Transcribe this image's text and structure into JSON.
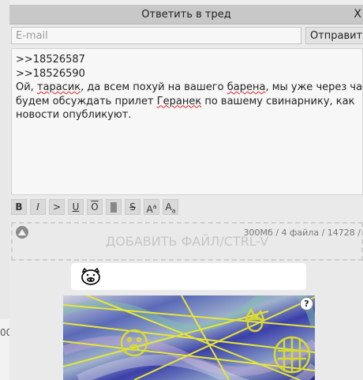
{
  "window": {
    "title": "Ответить в тред",
    "close_label": "X"
  },
  "form": {
    "email_placeholder": "E-mail",
    "send_label": "Отправить",
    "message_lines": [
      ">>18526587",
      ">>18526590",
      "Ой, тарасик, да всем похуй на вашего барена, мы уже через час",
      "будем обсуждать прилет Геранек по вашему свинарнику, как",
      "новости опубликуют."
    ],
    "limits_text": "300Мб / 4 файла / 14728 /"
  },
  "markup_buttons": [
    "B",
    "I",
    ">",
    "U",
    "O",
    "",
    "S",
    "Aa",
    "Aa"
  ],
  "dropzone_label": "ДОБАВИТЬ ФАЙЛ/CTRL-V",
  "captcha": {
    "help_label": "?"
  },
  "background": {
    "left_edge_text": "00"
  },
  "icons": [
    "attach-triangle-icon",
    "pig-icon",
    "help-icon",
    "close-icon"
  ]
}
